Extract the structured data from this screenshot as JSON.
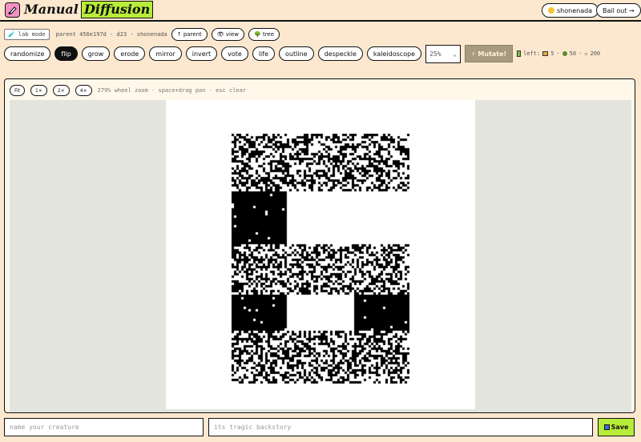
{
  "header": {
    "title_part1": "Manual",
    "title_part2": "Diffusion",
    "user_label": "shonenada",
    "bail_label": "Bail out →"
  },
  "info": {
    "lab_mode": "🧪 lab mode",
    "parent_text": "parent 456e197d · d23 · shonenada",
    "parent_btn": "↑ parent",
    "view_btn": "👁 view",
    "tree_btn": "🌳 tree"
  },
  "tools": [
    "randomize",
    "flip",
    "grow",
    "erode",
    "mirror",
    "invert",
    "vote",
    "life",
    "outline",
    "despeckle",
    "kaleidoscope"
  ],
  "active_tool": "flip",
  "zoom_select": {
    "value": "25%",
    "arrow": "⌄"
  },
  "mutate_label": "⚡ Mutate!",
  "budget": {
    "label": "left:",
    "tiles": "5",
    "dots": "50",
    "pixels": "200",
    "sep": "·",
    "pixel_glyph": "▫"
  },
  "canvas": {
    "zoom_buttons": [
      "Fit",
      "1×",
      "2×",
      "4×"
    ],
    "hint": "279% wheel zoom · space+drag pan · esc clear"
  },
  "bottom": {
    "name_placeholder": "name your creature",
    "story_placeholder": "its tragic backstory",
    "save_label": "Save"
  },
  "colors": {
    "background": "#fbe8cf",
    "accent": "#b7ec3a",
    "logo_pink": "#f291c4",
    "mutate_disabled": "#a89a7e"
  },
  "icons": {
    "logo": "paint-tube-icon",
    "user": "sun-face-icon",
    "save": "floppy-disk-icon",
    "budget_battery": "battery-icon",
    "budget_tiles": "tile-icon",
    "budget_dots": "dot-icon"
  }
}
